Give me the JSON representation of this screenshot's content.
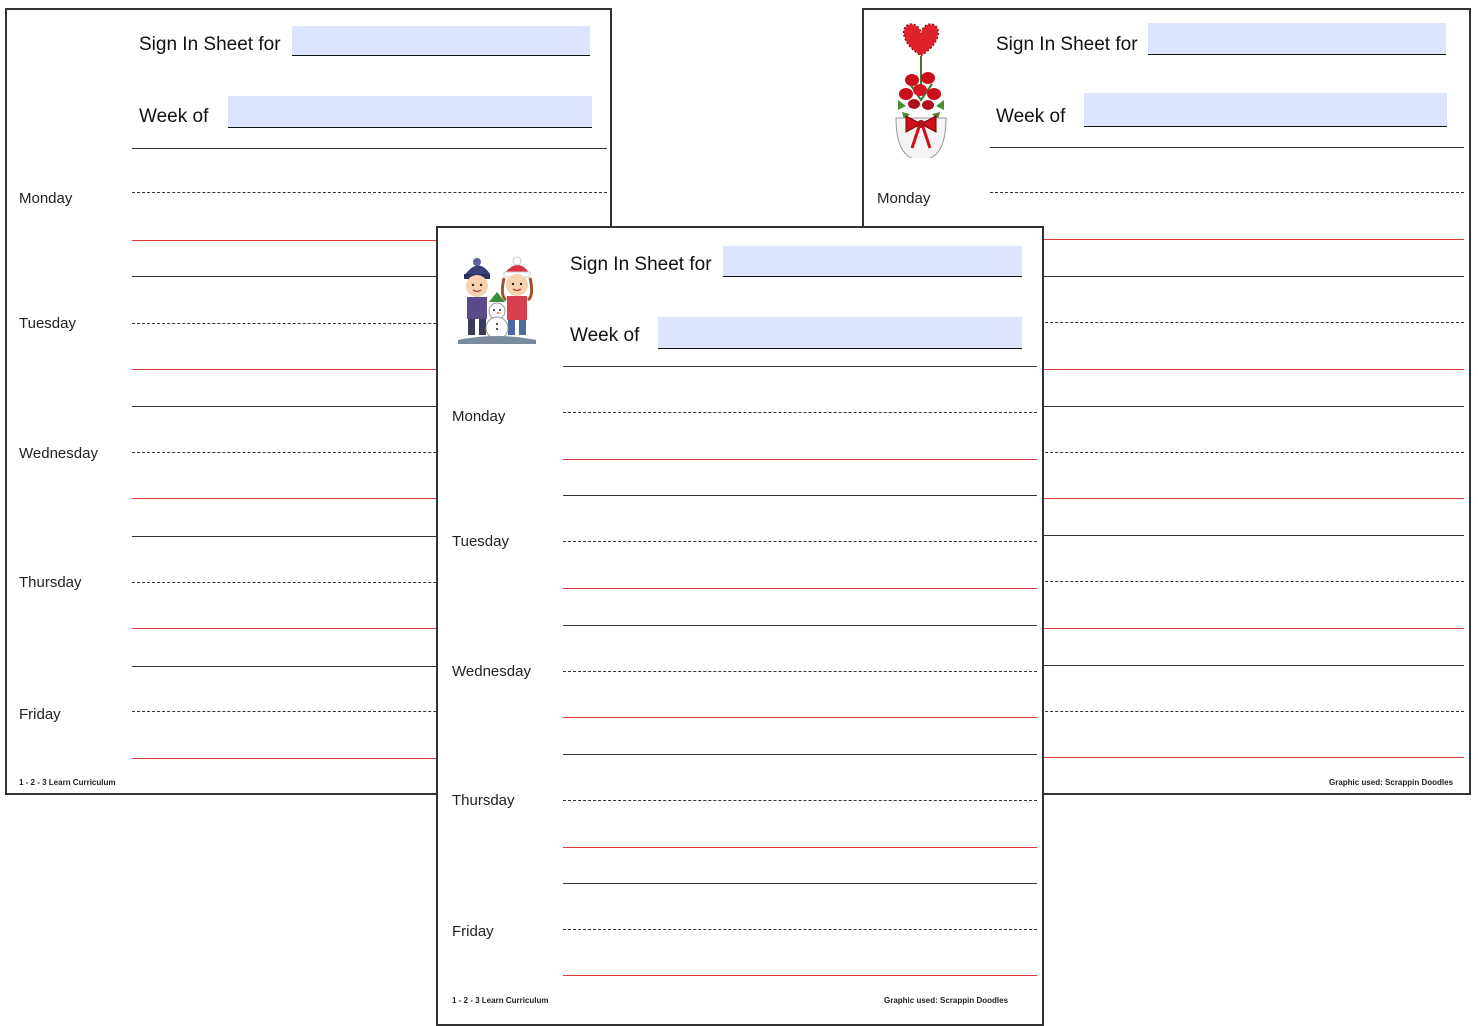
{
  "header": {
    "sign_in_label": "Sign In Sheet for",
    "week_label": "Week of"
  },
  "days": [
    "Monday",
    "Tuesday",
    "Wednesday",
    "Thursday",
    "Friday"
  ],
  "footer": {
    "credit_left": "1 - 2 - 3 Learn Curriculum",
    "credit_right": "Graphic used: Scrappin Doodles"
  },
  "icons": {
    "right_sheet": "heart-roses-vase-icon",
    "front_sheet": "winter-kids-snowman-icon"
  },
  "colors": {
    "field_fill": "#dde4ff",
    "writing_guide_red": "#e03a3a",
    "border": "#333333"
  }
}
